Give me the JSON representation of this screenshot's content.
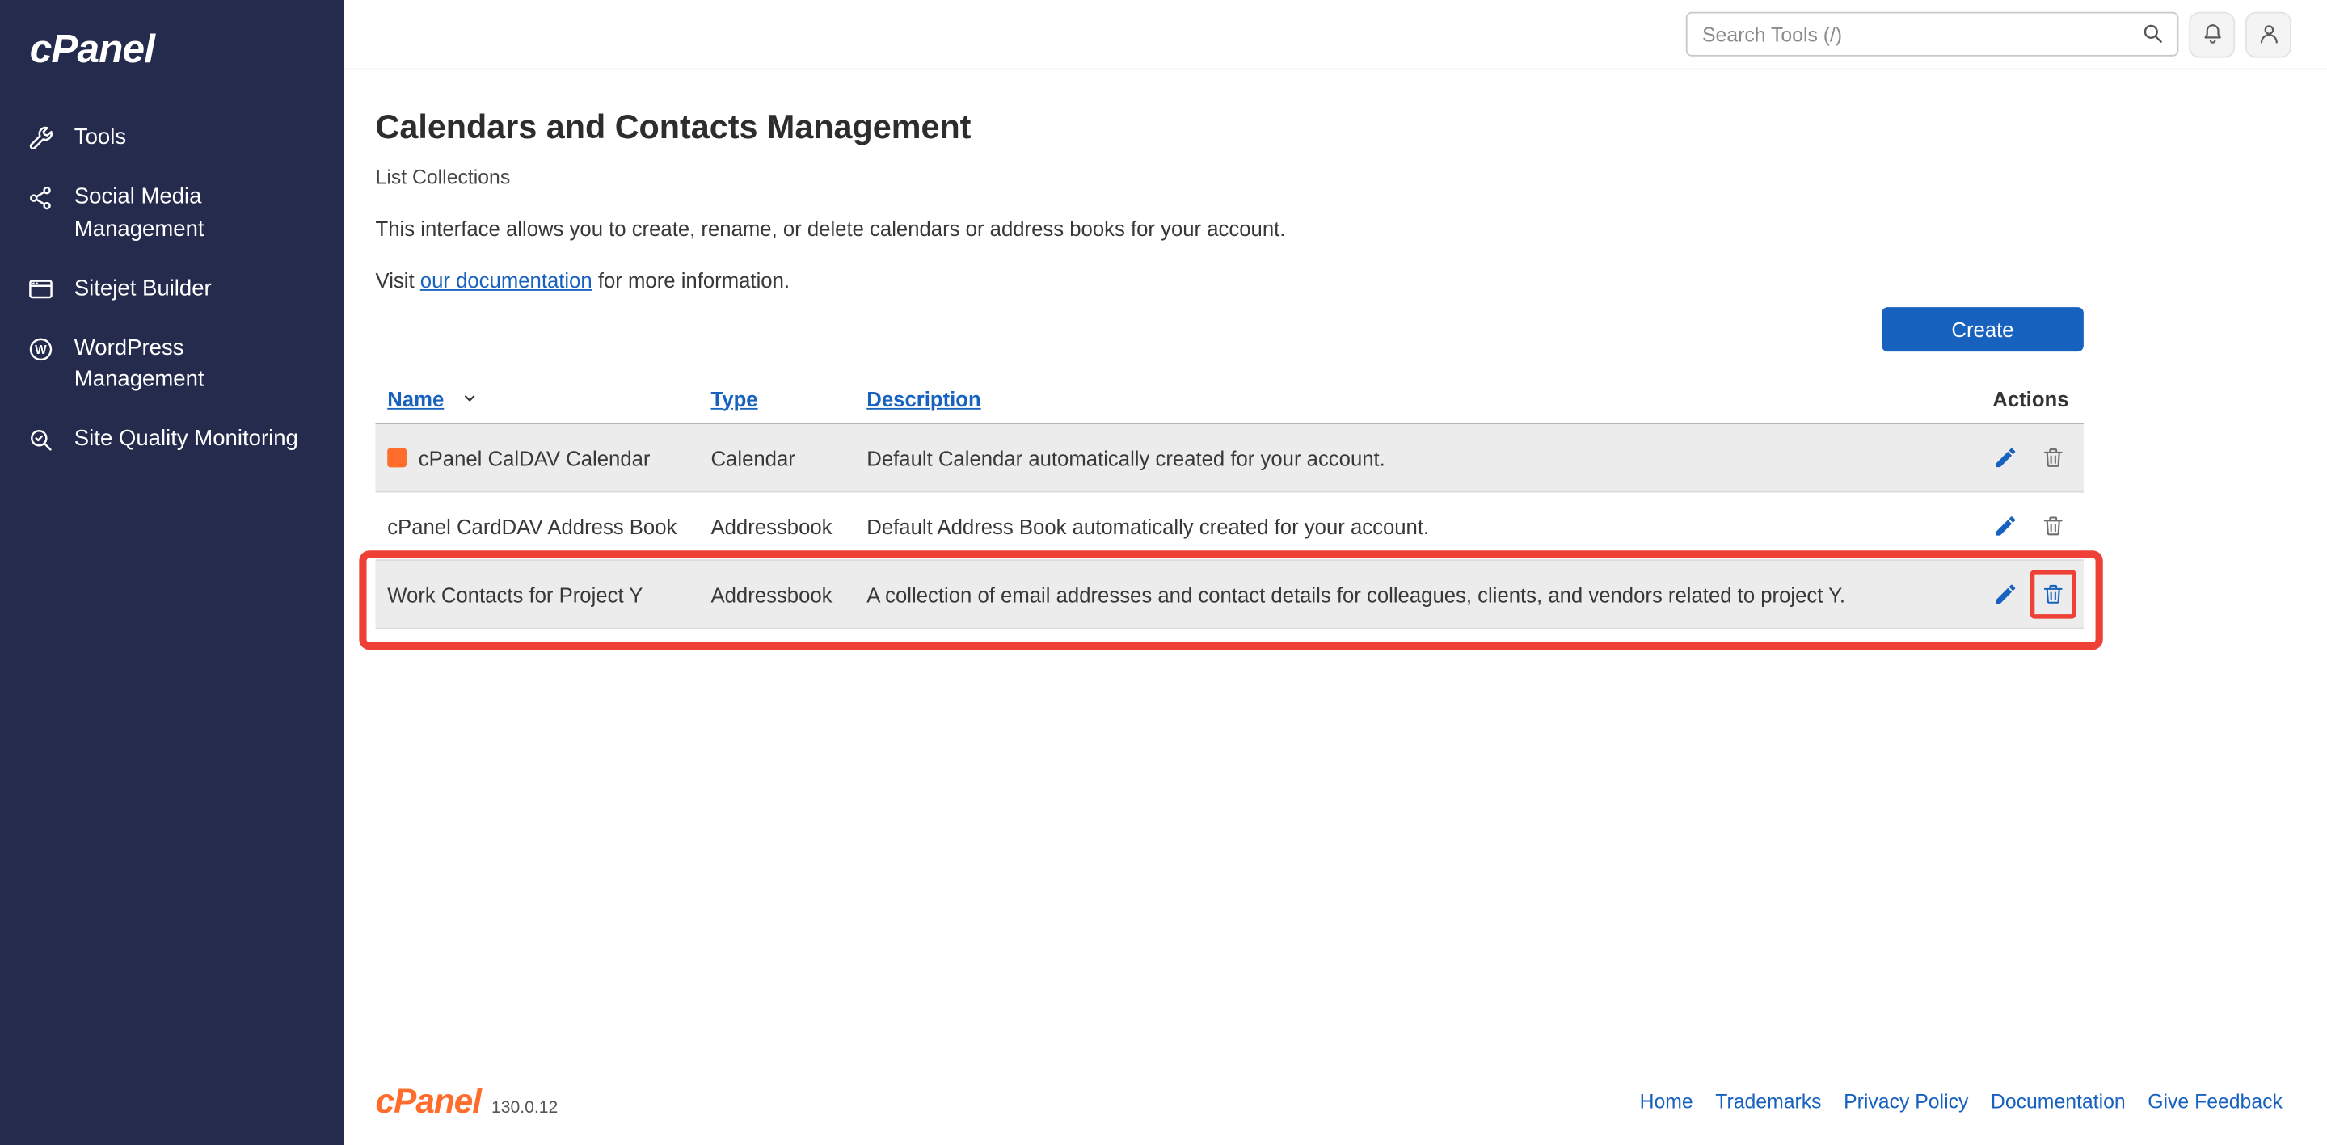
{
  "brand": {
    "logo_text": "cPanel",
    "footer_version": "130.0.12"
  },
  "topbar": {
    "search_placeholder": "Search Tools (/)",
    "icons": [
      "search-icon",
      "bell-icon",
      "user-icon"
    ]
  },
  "sidebar": {
    "items": [
      {
        "label": "Tools",
        "icon": "wrench-icon"
      },
      {
        "label": "Social Media Management",
        "icon": "share-nodes-icon"
      },
      {
        "label": "Sitejet Builder",
        "icon": "browser-window-icon"
      },
      {
        "label": "WordPress Management",
        "icon": "wordpress-icon"
      },
      {
        "label": "Site Quality Monitoring",
        "icon": "magnifier-check-icon"
      }
    ]
  },
  "page": {
    "title": "Calendars and Contacts Management",
    "subtitle": "List Collections",
    "intro": "This interface allows you to create, rename, or delete calendars or address books for your account.",
    "docs_prefix": "Visit ",
    "docs_link": "our documentation",
    "docs_suffix": " for more information.",
    "create_button": "Create"
  },
  "table": {
    "headers": {
      "name": "Name",
      "type": "Type",
      "description": "Description",
      "actions": "Actions"
    },
    "row_action_icons": [
      "edit-pencil-icon",
      "delete-trash-icon"
    ],
    "rows": [
      {
        "name": "cPanel CalDAV Calendar",
        "type": "Calendar",
        "description": "Default Calendar automatically created for your account.",
        "swatch_color": "#FF6C2C",
        "shaded": true,
        "highlighted": false
      },
      {
        "name": "cPanel CardDAV Address Book",
        "type": "Addressbook",
        "description": "Default Address Book automatically created for your account.",
        "shaded": false,
        "highlighted": false
      },
      {
        "name": "Work Contacts for Project Y",
        "type": "Addressbook",
        "description": "A collection of email addresses and contact details for colleagues, clients, and vendors related to project Y.",
        "shaded": true,
        "highlighted": true
      }
    ]
  },
  "footer": {
    "links": [
      "Home",
      "Trademarks",
      "Privacy Policy",
      "Documentation",
      "Give Feedback"
    ]
  },
  "colors": {
    "primary_blue": "#1761BF",
    "sidebar_bg": "#252B4D",
    "brand_orange": "#FF6C2C",
    "annotation_red": "#EE4036",
    "row_shading": "#ECECEC"
  }
}
